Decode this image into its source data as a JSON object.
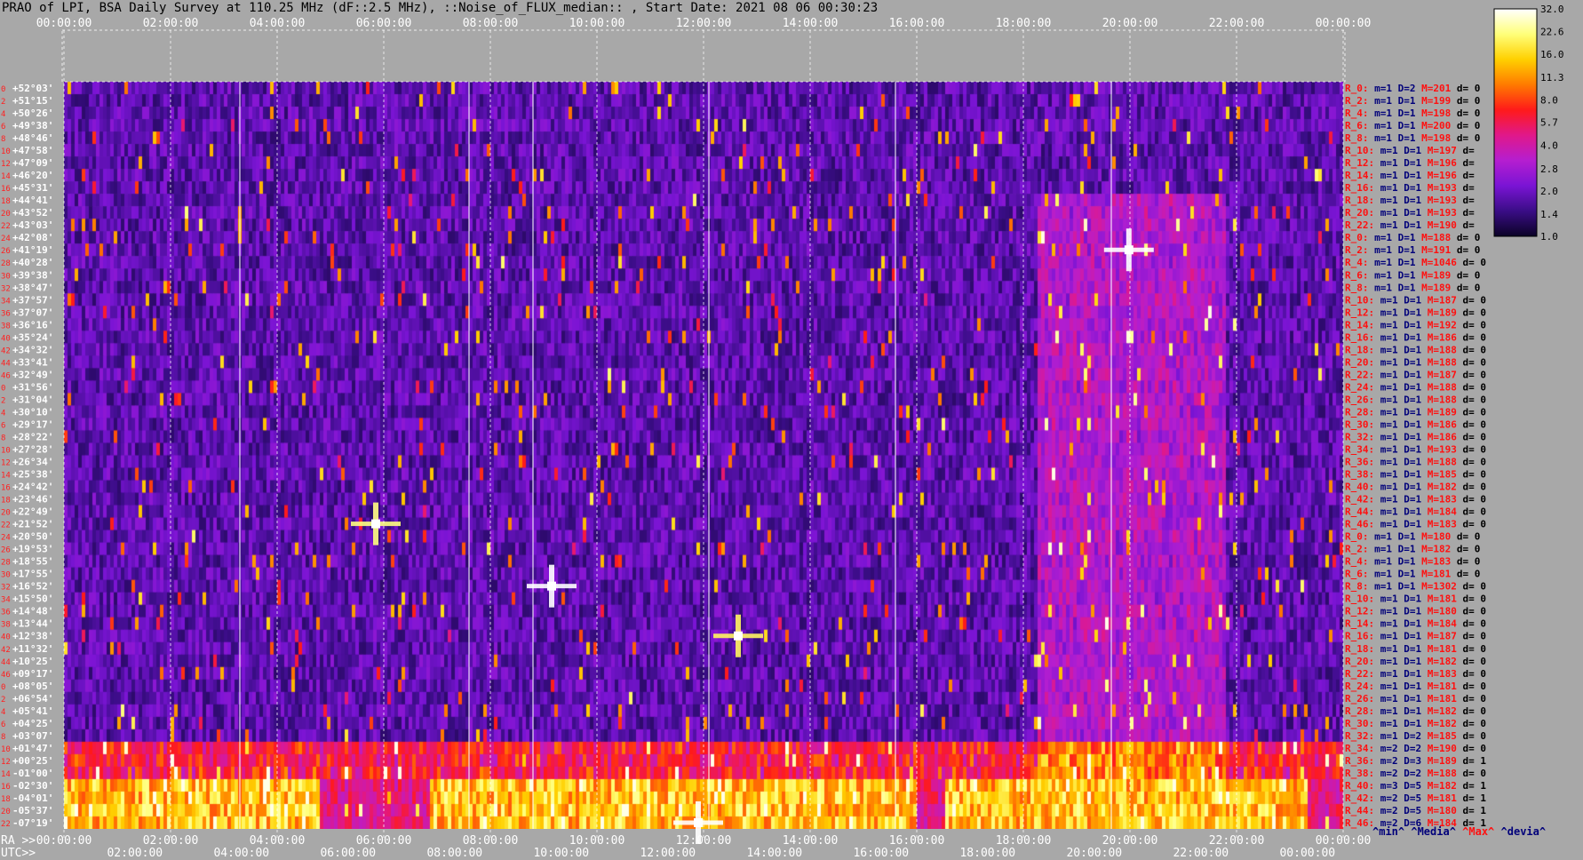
{
  "chart_data": {
    "type": "heatmap",
    "title": "PRAO of LPI, BSA Daily Survey at 110.25 MHz (dF::2.5 MHz), ::Noise_of_FLUX_median:: , Start Date: 2021 08 06 00:30:23",
    "x_top_ticks": [
      "00:00:00",
      "02:00:00",
      "04:00:00",
      "06:00:00",
      "08:00:00",
      "10:00:00",
      "12:00:00",
      "14:00:00",
      "16:00:00",
      "18:00:00",
      "20:00:00",
      "22:00:00",
      "00:00:00"
    ],
    "ra_label": "RA >>",
    "ra_ticks": [
      "00:00:00",
      "02:00:00",
      "04:00:00",
      "06:00:00",
      "08:00:00",
      "10:00:00",
      "12:00:00",
      "14:00:00",
      "16:00:00",
      "18:00:00",
      "20:00:00",
      "22:00:00",
      "00:00:00"
    ],
    "utc_label": "UTC>>",
    "utc_ticks": [
      "02:00:00",
      "04:00:00",
      "06:00:00",
      "08:00:00",
      "10:00:00",
      "12:00:00",
      "14:00:00",
      "16:00:00",
      "18:00:00",
      "20:00:00",
      "22:00:00",
      "00:00:00"
    ],
    "row_indices": [
      "0",
      "2",
      "4",
      "6",
      "8",
      "10",
      "12",
      "14",
      "16",
      "18",
      "20",
      "22",
      "24",
      "26",
      "28",
      "30",
      "32",
      "34",
      "36",
      "38",
      "40",
      "42",
      "44",
      "46",
      "0",
      "2",
      "4",
      "6",
      "8",
      "10",
      "12",
      "14",
      "16",
      "18",
      "20",
      "22",
      "24",
      "26",
      "28",
      "30",
      "32",
      "34",
      "36",
      "38",
      "40",
      "42",
      "44",
      "46",
      "0",
      "2",
      "4",
      "6",
      "8",
      "10",
      "12",
      "14",
      "16",
      "18",
      "20",
      "22",
      "24",
      "26",
      "28",
      "30",
      "32",
      "34",
      "36",
      "38",
      "40",
      "42",
      "44",
      "46"
    ],
    "declinations": [
      "+52°03'",
      "+51°15'",
      "+50°26'",
      "+49°38'",
      "+48°46'",
      "+47°58'",
      "+47°09'",
      "+46°20'",
      "+45°31'",
      "+44°41'",
      "+43°52'",
      "+43°03'",
      "+42°08'",
      "+41°19'",
      "+40°28'",
      "+39°38'",
      "+38°47'",
      "+37°57'",
      "+37°07'",
      "+36°16'",
      "+35°24'",
      "+34°32'",
      "+33°41'",
      "+32°49'",
      "+31°56'",
      "+31°04'",
      "+30°10'",
      "+29°17'",
      "+28°22'",
      "+27°28'",
      "+26°34'",
      "+25°38'",
      "+24°42'",
      "+23°46'",
      "+22°49'",
      "+21°52'",
      "+20°50'",
      "+19°53'",
      "+18°55'",
      "+17°55'",
      "+16°52'",
      "+15°50'",
      "+14°48'",
      "+13°44'",
      "+12°38'",
      "+11°32'",
      "+10°25'",
      "+09°17'",
      "+08°05'",
      "+06°54'",
      "+05°41'",
      "+04°25'",
      "+03°07'",
      "+01°47'",
      "+00°25'",
      "-01°00'",
      "-02°30'",
      "-04°01'",
      "-05°37'",
      "-07°19'"
    ],
    "stats": [
      {
        "r": "R_0:",
        "m": "m=1",
        "D": "D=2",
        "M": "M=201",
        "d": "d= 0"
      },
      {
        "r": "R_2:",
        "m": "m=1",
        "D": "D=1",
        "M": "M=199",
        "d": "d= 0"
      },
      {
        "r": "R_4:",
        "m": "m=1",
        "D": "D=1",
        "M": "M=198",
        "d": "d= 0"
      },
      {
        "r": "R_6:",
        "m": "m=1",
        "D": "D=1",
        "M": "M=200",
        "d": "d= 0"
      },
      {
        "r": "R_8:",
        "m": "m=1",
        "D": "D=1",
        "M": "M=198",
        "d": "d= 0"
      },
      {
        "r": "R_10:",
        "m": "m=1",
        "D": "D=1",
        "M": "M=197",
        "d": "d="
      },
      {
        "r": "R_12:",
        "m": "m=1",
        "D": "D=1",
        "M": "M=196",
        "d": "d="
      },
      {
        "r": "R_14:",
        "m": "m=1",
        "D": "D=1",
        "M": "M=196",
        "d": "d="
      },
      {
        "r": "R_16:",
        "m": "m=1",
        "D": "D=1",
        "M": "M=193",
        "d": "d="
      },
      {
        "r": "R_18:",
        "m": "m=1",
        "D": "D=1",
        "M": "M=193",
        "d": "d="
      },
      {
        "r": "R_20:",
        "m": "m=1",
        "D": "D=1",
        "M": "M=193",
        "d": "d="
      },
      {
        "r": "R_22:",
        "m": "m=1",
        "D": "D=1",
        "M": "M=190",
        "d": "d="
      },
      {
        "r": "R_0:",
        "m": "m=1",
        "D": "D=1",
        "M": "M=188",
        "d": "d= 0"
      },
      {
        "r": "R_2:",
        "m": "m=1",
        "D": "D=1",
        "M": "M=191",
        "d": "d= 0"
      },
      {
        "r": "R_4:",
        "m": "m=1",
        "D": "D=1",
        "M": "M=1046",
        "d": "d= 0"
      },
      {
        "r": "R_6:",
        "m": "m=1",
        "D": "D=1",
        "M": "M=189",
        "d": "d= 0"
      },
      {
        "r": "R_8:",
        "m": "m=1",
        "D": "D=1",
        "M": "M=189",
        "d": "d= 0"
      },
      {
        "r": "R_10:",
        "m": "m=1",
        "D": "D=1",
        "M": "M=187",
        "d": "d= 0"
      },
      {
        "r": "R_12:",
        "m": "m=1",
        "D": "D=1",
        "M": "M=189",
        "d": "d= 0"
      },
      {
        "r": "R_14:",
        "m": "m=1",
        "D": "D=1",
        "M": "M=192",
        "d": "d= 0"
      },
      {
        "r": "R_16:",
        "m": "m=1",
        "D": "D=1",
        "M": "M=186",
        "d": "d= 0"
      },
      {
        "r": "R_18:",
        "m": "m=1",
        "D": "D=1",
        "M": "M=188",
        "d": "d= 0"
      },
      {
        "r": "R_20:",
        "m": "m=1",
        "D": "D=1",
        "M": "M=188",
        "d": "d= 0"
      },
      {
        "r": "R_22:",
        "m": "m=1",
        "D": "D=1",
        "M": "M=187",
        "d": "d= 0"
      },
      {
        "r": "R_24:",
        "m": "m=1",
        "D": "D=1",
        "M": "M=188",
        "d": "d= 0"
      },
      {
        "r": "R_26:",
        "m": "m=1",
        "D": "D=1",
        "M": "M=188",
        "d": "d= 0"
      },
      {
        "r": "R_28:",
        "m": "m=1",
        "D": "D=1",
        "M": "M=189",
        "d": "d= 0"
      },
      {
        "r": "R_30:",
        "m": "m=1",
        "D": "D=1",
        "M": "M=186",
        "d": "d= 0"
      },
      {
        "r": "R_32:",
        "m": "m=1",
        "D": "D=1",
        "M": "M=186",
        "d": "d= 0"
      },
      {
        "r": "R_34:",
        "m": "m=1",
        "D": "D=1",
        "M": "M=193",
        "d": "d= 0"
      },
      {
        "r": "R_36:",
        "m": "m=1",
        "D": "D=1",
        "M": "M=188",
        "d": "d= 0"
      },
      {
        "r": "R_38:",
        "m": "m=1",
        "D": "D=1",
        "M": "M=185",
        "d": "d= 0"
      },
      {
        "r": "R_40:",
        "m": "m=1",
        "D": "D=1",
        "M": "M=182",
        "d": "d= 0"
      },
      {
        "r": "R_42:",
        "m": "m=1",
        "D": "D=1",
        "M": "M=183",
        "d": "d= 0"
      },
      {
        "r": "R_44:",
        "m": "m=1",
        "D": "D=1",
        "M": "M=184",
        "d": "d= 0"
      },
      {
        "r": "R_46:",
        "m": "m=1",
        "D": "D=1",
        "M": "M=183",
        "d": "d= 0"
      },
      {
        "r": "R_0:",
        "m": "m=1",
        "D": "D=1",
        "M": "M=180",
        "d": "d= 0"
      },
      {
        "r": "R_2:",
        "m": "m=1",
        "D": "D=1",
        "M": "M=182",
        "d": "d= 0"
      },
      {
        "r": "R_4:",
        "m": "m=1",
        "D": "D=1",
        "M": "M=183",
        "d": "d= 0"
      },
      {
        "r": "R_6:",
        "m": "m=1",
        "D": "D=1",
        "M": "M=181",
        "d": "d= 0"
      },
      {
        "r": "R_8:",
        "m": "m=1",
        "D": "D=1",
        "M": "M=1302",
        "d": "d= 0"
      },
      {
        "r": "R_10:",
        "m": "m=1",
        "D": "D=1",
        "M": "M=181",
        "d": "d= 0"
      },
      {
        "r": "R_12:",
        "m": "m=1",
        "D": "D=1",
        "M": "M=180",
        "d": "d= 0"
      },
      {
        "r": "R_14:",
        "m": "m=1",
        "D": "D=1",
        "M": "M=184",
        "d": "d= 0"
      },
      {
        "r": "R_16:",
        "m": "m=1",
        "D": "D=1",
        "M": "M=187",
        "d": "d= 0"
      },
      {
        "r": "R_18:",
        "m": "m=1",
        "D": "D=1",
        "M": "M=181",
        "d": "d= 0"
      },
      {
        "r": "R_20:",
        "m": "m=1",
        "D": "D=1",
        "M": "M=182",
        "d": "d= 0"
      },
      {
        "r": "R_22:",
        "m": "m=1",
        "D": "D=1",
        "M": "M=183",
        "d": "d= 0"
      },
      {
        "r": "R_24:",
        "m": "m=1",
        "D": "D=1",
        "M": "M=181",
        "d": "d= 0"
      },
      {
        "r": "R_26:",
        "m": "m=1",
        "D": "D=1",
        "M": "M=181",
        "d": "d= 0"
      },
      {
        "r": "R_28:",
        "m": "m=1",
        "D": "D=1",
        "M": "M=182",
        "d": "d= 0"
      },
      {
        "r": "R_30:",
        "m": "m=1",
        "D": "D=1",
        "M": "M=182",
        "d": "d= 0"
      },
      {
        "r": "R_32:",
        "m": "m=1",
        "D": "D=2",
        "M": "M=185",
        "d": "d= 0"
      },
      {
        "r": "R_34:",
        "m": "m=2",
        "D": "D=2",
        "M": "M=190",
        "d": "d= 0"
      },
      {
        "r": "R_36:",
        "m": "m=2",
        "D": "D=3",
        "M": "M=189",
        "d": "d= 1"
      },
      {
        "r": "R_38:",
        "m": "m=2",
        "D": "D=2",
        "M": "M=188",
        "d": "d= 0"
      },
      {
        "r": "R_40:",
        "m": "m=3",
        "D": "D=5",
        "M": "M=182",
        "d": "d= 1"
      },
      {
        "r": "R_42:",
        "m": "m=2",
        "D": "D=5",
        "M": "M=181",
        "d": "d= 1"
      },
      {
        "r": "R_44:",
        "m": "m=2",
        "D": "D=5",
        "M": "M=180",
        "d": "d= 1"
      },
      {
        "r": "R_46:",
        "m": "m=2",
        "D": "D=6",
        "M": "M=184",
        "d": "d= 1"
      }
    ],
    "stats_legend": [
      "^min^",
      "^Media^",
      "^Max^",
      "^devia^"
    ],
    "colorbar_ticks": [
      "32.0",
      "22.6",
      "16.0",
      "11.3",
      "8.0",
      "5.7",
      "4.0",
      "2.8",
      "2.0",
      "1.4",
      "1.0"
    ],
    "colorbar_range": [
      1.0,
      32.0
    ],
    "colorscale": [
      "#0b0226",
      "#3a0d86",
      "#7a14d4",
      "#b51ed0",
      "#e0188a",
      "#ff1a1a",
      "#ff7a00",
      "#ffd000",
      "#ffff7a",
      "#ffffff"
    ],
    "colors": {
      "background": "#a8a8a8",
      "title": "#000000",
      "time_tick": "#ffffff",
      "row_index": "#ff2020",
      "stat_r": "#ff1010",
      "stat_m": "#00007a",
      "stat_M": "#ff1010",
      "stat_d": "#000000",
      "legend_min": "#00007a",
      "legend_max": "#ff1010"
    },
    "bright_sources": [
      {
        "ra_h": 19.98,
        "dec_row": 13,
        "level": 32
      },
      {
        "ra_h": 9.15,
        "dec_row": 40,
        "level": 32
      },
      {
        "ra_h": 5.85,
        "dec_row": 35,
        "level": 22
      },
      {
        "ra_h": 12.65,
        "dec_row": 44,
        "level": 20
      },
      {
        "ra_h": 11.9,
        "dec_row": 59,
        "level": 32
      }
    ]
  }
}
